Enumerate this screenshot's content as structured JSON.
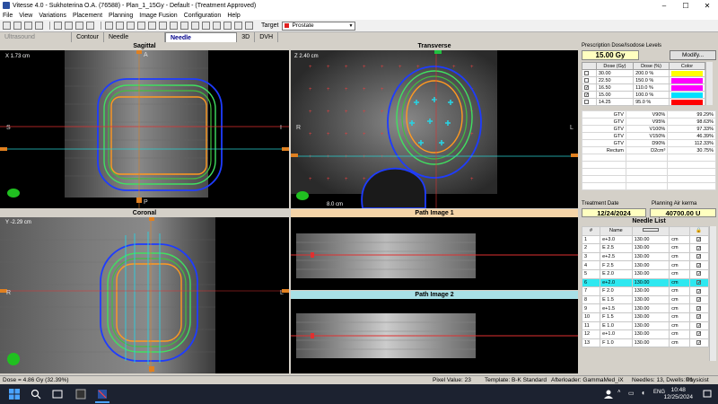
{
  "window": {
    "title": "Vitesse 4.0 - Sukhoterina O.A. (76588) - Plan_1_15Gy - Default - (Treatment Approved)"
  },
  "menu": [
    "File",
    "View",
    "Variations",
    "Placement",
    "Planning",
    "Image Fusion",
    "Configuration",
    "Help"
  ],
  "toolbar": {
    "target_label": "Target",
    "target_value": "Prostate",
    "target_color": "#e02020"
  },
  "tabs": [
    {
      "label": "Ultrasound Acquisition",
      "state": "disabled"
    },
    {
      "label": "Contour",
      "state": "normal"
    },
    {
      "label": "Needle Placement",
      "state": "normal"
    },
    {
      "label": "Needle Identification",
      "state": "active"
    },
    {
      "label": "3D",
      "state": "normal"
    },
    {
      "label": "DVH",
      "state": "normal"
    }
  ],
  "views": {
    "sagittal": {
      "title": "Sagittal",
      "coord": "X 1.73 cm",
      "top": "A",
      "bottom": "P",
      "left": "S",
      "right": "I"
    },
    "transverse": {
      "title": "Transverse",
      "coord": "Z 2.40 cm",
      "left": "R",
      "right": "L",
      "scale": "8.0 cm"
    },
    "coronal": {
      "title": "Coronal",
      "coord": "Y -2.29 cm",
      "left": "R",
      "right": "L"
    },
    "path1": {
      "title": "Path Image 1"
    },
    "path2": {
      "title": "Path Image 2"
    }
  },
  "prescription": {
    "header": "Prescription Dose/Isodose Levels",
    "dose": "15.00 Gy",
    "modify_label": "Modify...",
    "columns": [
      "Dose (Gy)",
      "Dose (%)",
      "Color"
    ],
    "levels": [
      {
        "checked": false,
        "dose": "30.00",
        "pct": "200.0 %",
        "color": "#ffff00"
      },
      {
        "checked": false,
        "dose": "22.50",
        "pct": "150.0 %",
        "color": "#ff00ff"
      },
      {
        "checked": true,
        "dose": "16.50",
        "pct": "110.0 %",
        "color": "#ff00ff"
      },
      {
        "checked": true,
        "dose": "15.00",
        "pct": "100.0 %",
        "color": "#00e0ff"
      },
      {
        "checked": false,
        "dose": "14.25",
        "pct": "95.0 %",
        "color": "#ff0000"
      }
    ]
  },
  "dvh": [
    {
      "structure": "GTV",
      "metric": "V90%",
      "value": "99.29%"
    },
    {
      "structure": "GTV",
      "metric": "V95%",
      "value": "98.63%"
    },
    {
      "structure": "GTV",
      "metric": "V100%",
      "value": "97.33%"
    },
    {
      "structure": "GTV",
      "metric": "V150%",
      "value": "46.39%"
    },
    {
      "structure": "GTV",
      "metric": "D90%",
      "value": "112.33%"
    },
    {
      "structure": "Rectum",
      "metric": "D2cm³",
      "value": "30.75%"
    }
  ],
  "treatment": {
    "date_label": "Treatment Date",
    "date_value": "12/24/2024",
    "airkerma_label": "Planning Air kerma",
    "airkerma_value": "40700.00 U"
  },
  "needle_list": {
    "title": "Needle List",
    "columns": [
      "#",
      "Name",
      "",
      "",
      ""
    ],
    "rows": [
      {
        "n": "1",
        "name": "e+3.0",
        "len": "130.00",
        "unit": "cm",
        "checked": true
      },
      {
        "n": "2",
        "name": "E 2.5",
        "len": "130.00",
        "unit": "cm",
        "checked": true
      },
      {
        "n": "3",
        "name": "e+2.5",
        "len": "130.00",
        "unit": "cm",
        "checked": true
      },
      {
        "n": "4",
        "name": "F 2.5",
        "len": "130.00",
        "unit": "cm",
        "checked": true
      },
      {
        "n": "5",
        "name": "E 2.0",
        "len": "130.00",
        "unit": "cm",
        "checked": true
      },
      {
        "n": "6",
        "name": "e+2.0",
        "len": "130.00",
        "unit": "cm",
        "checked": true
      },
      {
        "n": "7",
        "name": "F 2.0",
        "len": "130.00",
        "unit": "cm",
        "checked": true
      },
      {
        "n": "8",
        "name": "E 1.5",
        "len": "130.00",
        "unit": "cm",
        "checked": true
      },
      {
        "n": "9",
        "name": "e+1.5",
        "len": "130.00",
        "unit": "cm",
        "checked": true
      },
      {
        "n": "10",
        "name": "F 1.5",
        "len": "130.00",
        "unit": "cm",
        "checked": true
      },
      {
        "n": "11",
        "name": "E 1.0",
        "len": "130.00",
        "unit": "cm",
        "checked": true
      },
      {
        "n": "12",
        "name": "e+1.0",
        "len": "130.00",
        "unit": "cm",
        "checked": true
      },
      {
        "n": "13",
        "name": "F 1.0",
        "len": "130.00",
        "unit": "cm",
        "checked": true
      }
    ],
    "selected_index": 5
  },
  "status": {
    "dose": "Dose = 4.86 Gy (32.39%)",
    "pixel": "Pixel Value: 23",
    "template": "Template: B-K Standard",
    "afterloader": "Afterloader: GammaMed_iX",
    "needles": "Needles: 13, Dwells: 91",
    "user": "Physicist"
  },
  "taskbar": {
    "time": "10:48",
    "date": "12/25/2024",
    "lang": "ENG"
  }
}
